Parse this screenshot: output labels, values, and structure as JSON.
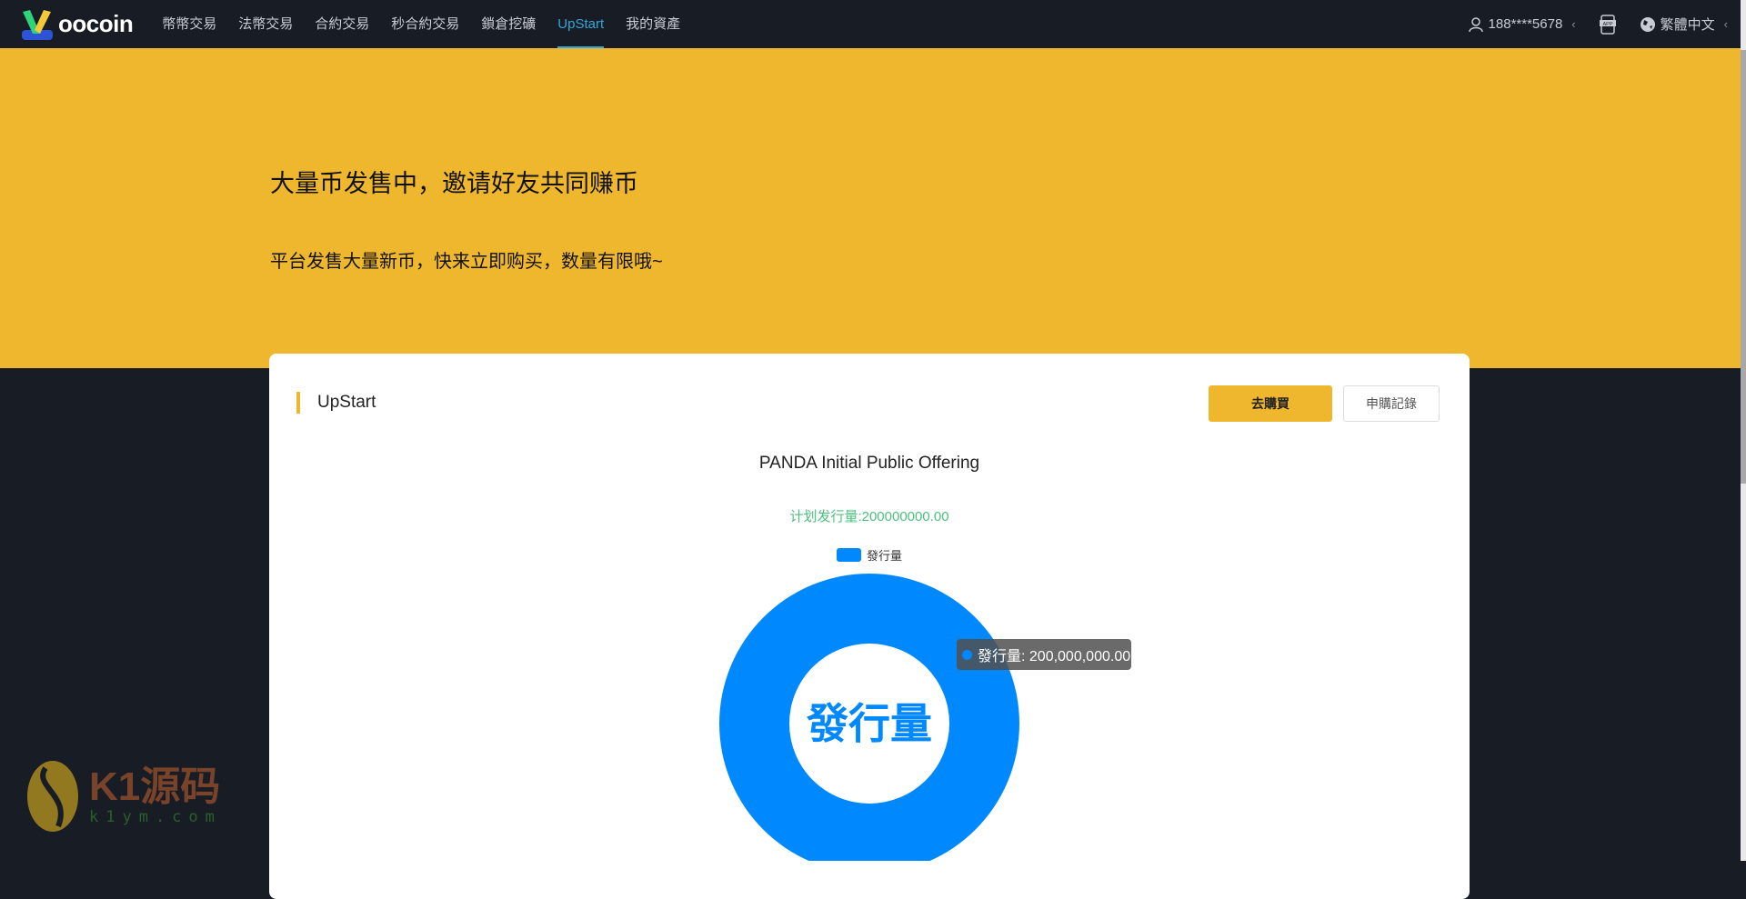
{
  "nav": {
    "logo_text": "oocoin",
    "items": [
      "幣幣交易",
      "法幣交易",
      "合約交易",
      "秒合約交易",
      "鎖倉挖礦",
      "UpStart",
      "我的資產"
    ],
    "active": "UpStart",
    "user": "188****5678",
    "app_label": "APP",
    "language": "繁體中文"
  },
  "banner": {
    "title": "大量币发售中，邀请好友共同赚币",
    "subtitle": "平台发售大量新币，快来立即购买，数量有限哦~"
  },
  "card": {
    "title": "UpStart",
    "buy_button": "去購買",
    "records_button": "申購記錄"
  },
  "chart_data": {
    "type": "pie",
    "title": "PANDA Initial Public Offering",
    "subtitle": "计划发行量:200000000.00",
    "legend": [
      "發行量"
    ],
    "legend_position": "top",
    "center_label": "發行量",
    "slices": [
      {
        "name": "發行量",
        "value": 200000000,
        "color": "#0088fe"
      }
    ],
    "tooltip": "發行量: 200,000,000.00"
  },
  "watermark": {
    "text": "K1源码",
    "url_text": "k1ym.com"
  },
  "colors": {
    "accent": "#efb72e",
    "nav_active": "#2fa8dc",
    "chart": "#0088fe",
    "subtitle_green": "#4cbf80"
  }
}
